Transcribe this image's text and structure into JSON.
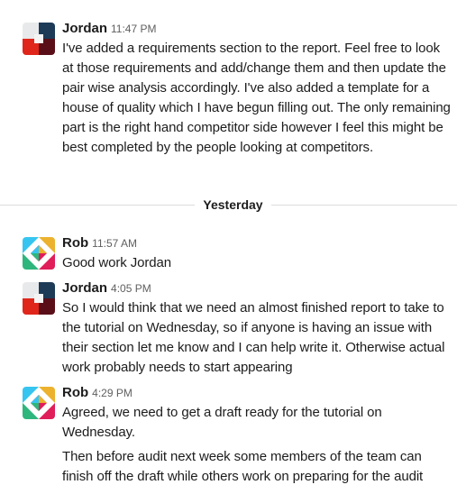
{
  "divider": {
    "label": "Yesterday"
  },
  "messages": [
    {
      "author": "Jordan",
      "time": "11:47 PM",
      "avatar_icon": "jordan-avatar-icon",
      "lines": [
        "I've added a requirements section to the report. Feel free to look at those requirements and add/change them and then update the pair wise analysis accordingly. I've also added a template for a house of quality which I have begun filling out. The only remaining part is the right hand competitor side however I feel this might be best completed by the people looking at competitors."
      ]
    },
    {
      "author": "Rob",
      "time": "11:57 AM",
      "avatar_icon": "rob-avatar-icon",
      "lines": [
        "Good work Jordan"
      ]
    },
    {
      "author": "Jordan",
      "time": "4:05 PM",
      "avatar_icon": "jordan-avatar-icon",
      "lines": [
        "So I would think that we need an almost finished report to take to the tutorial on Wednesday, so if anyone is having an issue with their section let me know and I can help write it. Otherwise actual work probably needs to start appearing"
      ]
    },
    {
      "author": "Rob",
      "time": "4:29 PM",
      "avatar_icon": "rob-avatar-icon",
      "lines": [
        "Agreed, we need to get a draft ready for the tutorial on Wednesday.",
        "Then before audit next week some members of the team can finish off the draft while others work on preparing for the audit"
      ]
    }
  ],
  "colors": {
    "text": "#1d1c1d",
    "timestamp": "#616061",
    "divider": "#dddddd",
    "jordan_avatar": [
      "#1d3b57",
      "#e8e9ea",
      "#e0261b",
      "#5a0f18"
    ],
    "rob_avatar": [
      "#36c5f0",
      "#ecb22e",
      "#2eb67d",
      "#e01e5a"
    ]
  }
}
